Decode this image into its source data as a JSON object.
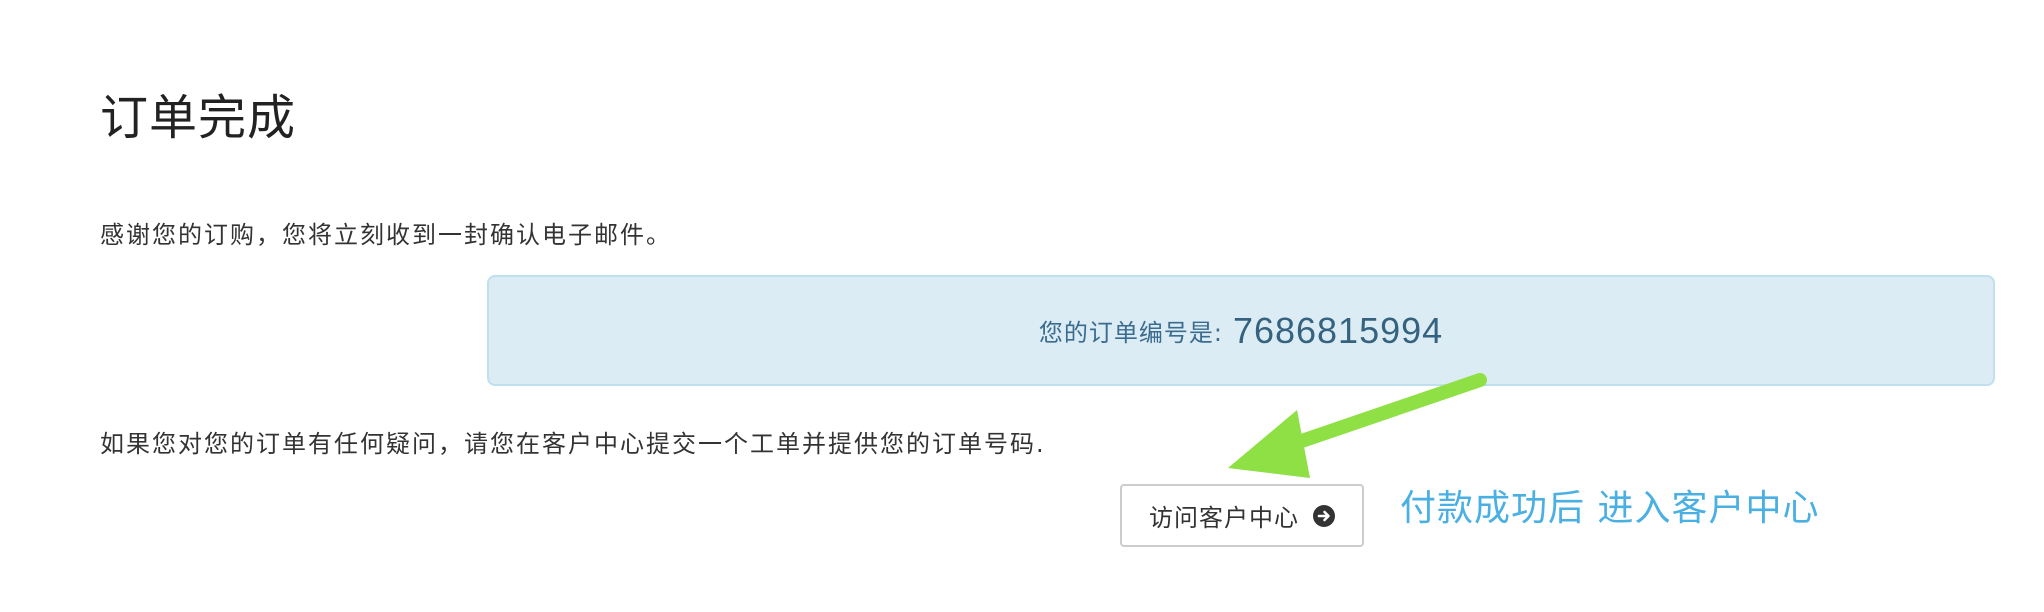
{
  "page": {
    "title": "订单完成",
    "thanks_message": "感谢您的订购，您将立刻收到一封确认电子邮件。"
  },
  "order": {
    "label": "您的订单编号是:",
    "number": "7686815994"
  },
  "help": {
    "message": "如果您对您的订单有任何疑问，请您在客户中心提交一个工单并提供您的订单号码."
  },
  "actions": {
    "visit_client_area_label": "访问客户中心",
    "visit_client_area_icon": "arrow-circle-right-icon"
  },
  "annotation": {
    "text": "付款成功后 进入客户中心",
    "color": "#4ab0e4",
    "arrow_color": "#8ee045"
  },
  "colors": {
    "info_box_bg": "#dcecf5",
    "info_box_border": "#bfe0ef",
    "info_text": "#35627f"
  }
}
